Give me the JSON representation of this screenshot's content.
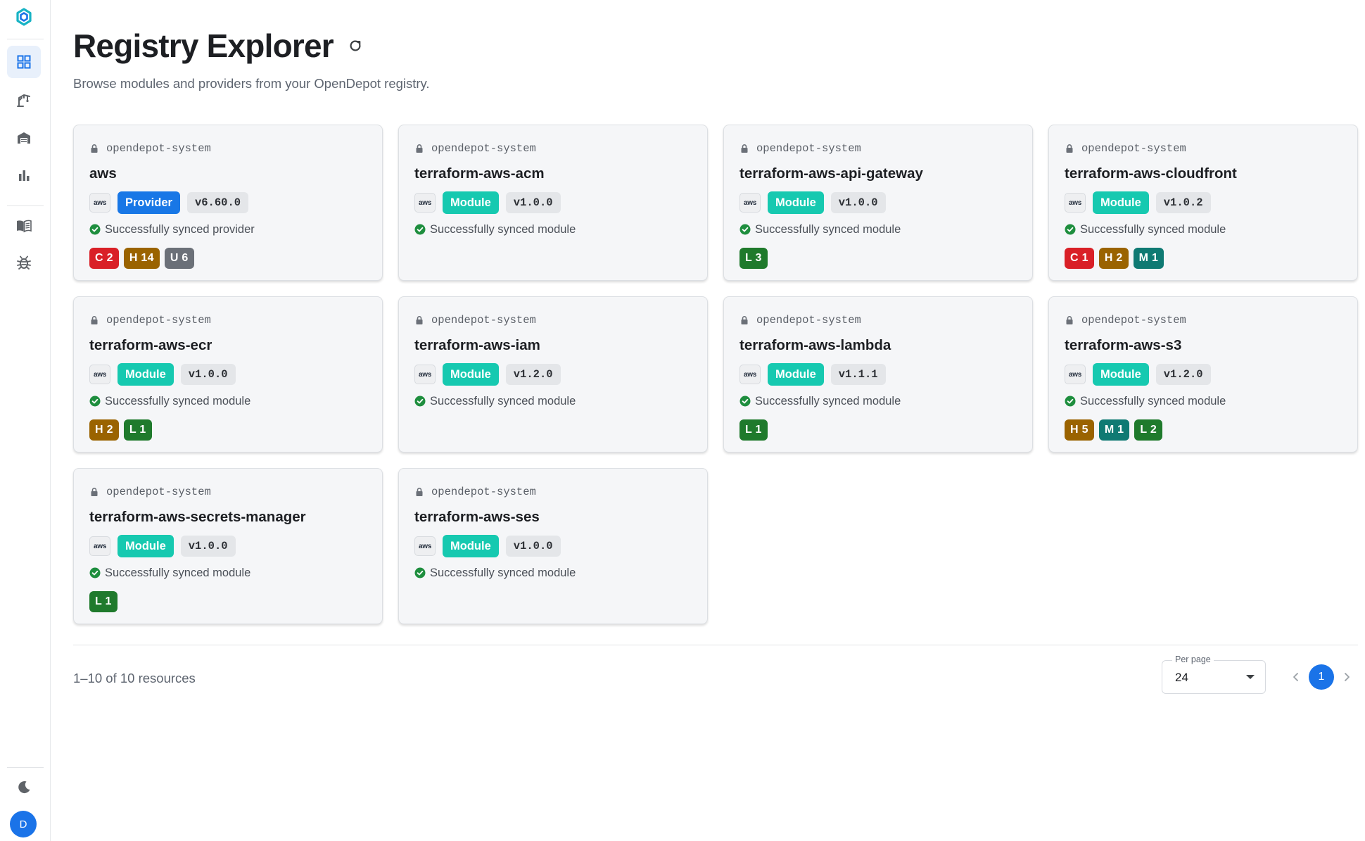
{
  "app": {
    "user_initial": "D"
  },
  "colors": {
    "accent": "#1a73e8",
    "provider": "#1877e6",
    "module": "#16c9b0",
    "severity": {
      "C": "#d92027",
      "H": "#9a6300",
      "U": "#6b7078",
      "M": "#0f7a73",
      "L": "#1f7a2c"
    },
    "success": "#1e8e3e"
  },
  "sidebar": {
    "items": [
      {
        "icon": "grid-icon",
        "active": true
      },
      {
        "icon": "crane-icon",
        "active": false
      },
      {
        "icon": "warehouse-icon",
        "active": false
      },
      {
        "icon": "bar-chart-icon",
        "active": false
      },
      {
        "icon": "book-icon",
        "active": false
      },
      {
        "icon": "bug-icon",
        "active": false
      }
    ],
    "bottom": [
      {
        "icon": "moon-icon"
      },
      {
        "icon": "avatar"
      }
    ]
  },
  "header": {
    "title": "Registry Explorer",
    "subtitle": "Browse modules and providers from your OpenDepot registry."
  },
  "resources": [
    {
      "namespace": "opendepot-system",
      "name": "aws",
      "kind": "Provider",
      "version": "v6.60.0",
      "status": "Successfully synced provider",
      "severities": [
        {
          "label": "C 2",
          "level": "C"
        },
        {
          "label": "H 14",
          "level": "H"
        },
        {
          "label": "U 6",
          "level": "U"
        }
      ]
    },
    {
      "namespace": "opendepot-system",
      "name": "terraform-aws-acm",
      "kind": "Module",
      "version": "v1.0.0",
      "status": "Successfully synced module",
      "severities": []
    },
    {
      "namespace": "opendepot-system",
      "name": "terraform-aws-api-gateway",
      "kind": "Module",
      "version": "v1.0.0",
      "status": "Successfully synced module",
      "severities": [
        {
          "label": "L 3",
          "level": "L"
        }
      ]
    },
    {
      "namespace": "opendepot-system",
      "name": "terraform-aws-cloudfront",
      "kind": "Module",
      "version": "v1.0.2",
      "status": "Successfully synced module",
      "severities": [
        {
          "label": "C 1",
          "level": "C"
        },
        {
          "label": "H 2",
          "level": "H"
        },
        {
          "label": "M 1",
          "level": "M"
        }
      ]
    },
    {
      "namespace": "opendepot-system",
      "name": "terraform-aws-ecr",
      "kind": "Module",
      "version": "v1.0.0",
      "status": "Successfully synced module",
      "severities": [
        {
          "label": "H 2",
          "level": "H"
        },
        {
          "label": "L 1",
          "level": "L"
        }
      ]
    },
    {
      "namespace": "opendepot-system",
      "name": "terraform-aws-iam",
      "kind": "Module",
      "version": "v1.2.0",
      "status": "Successfully synced module",
      "severities": []
    },
    {
      "namespace": "opendepot-system",
      "name": "terraform-aws-lambda",
      "kind": "Module",
      "version": "v1.1.1",
      "status": "Successfully synced module",
      "severities": [
        {
          "label": "L 1",
          "level": "L"
        }
      ]
    },
    {
      "namespace": "opendepot-system",
      "name": "terraform-aws-s3",
      "kind": "Module",
      "version": "v1.2.0",
      "status": "Successfully synced module",
      "severities": [
        {
          "label": "H 5",
          "level": "H"
        },
        {
          "label": "M 1",
          "level": "M"
        },
        {
          "label": "L 2",
          "level": "L"
        }
      ]
    },
    {
      "namespace": "opendepot-system",
      "name": "terraform-aws-secrets-manager",
      "kind": "Module",
      "version": "v1.0.0",
      "status": "Successfully synced module",
      "severities": [
        {
          "label": "L 1",
          "level": "L"
        }
      ]
    },
    {
      "namespace": "opendepot-system",
      "name": "terraform-aws-ses",
      "kind": "Module",
      "version": "v1.0.0",
      "status": "Successfully synced module",
      "severities": []
    }
  ],
  "aws_logo_text": "aws",
  "footer": {
    "count_text": "1–10 of 10 resources",
    "per_page_label": "Per page",
    "per_page_value": "24",
    "current_page": "1"
  }
}
